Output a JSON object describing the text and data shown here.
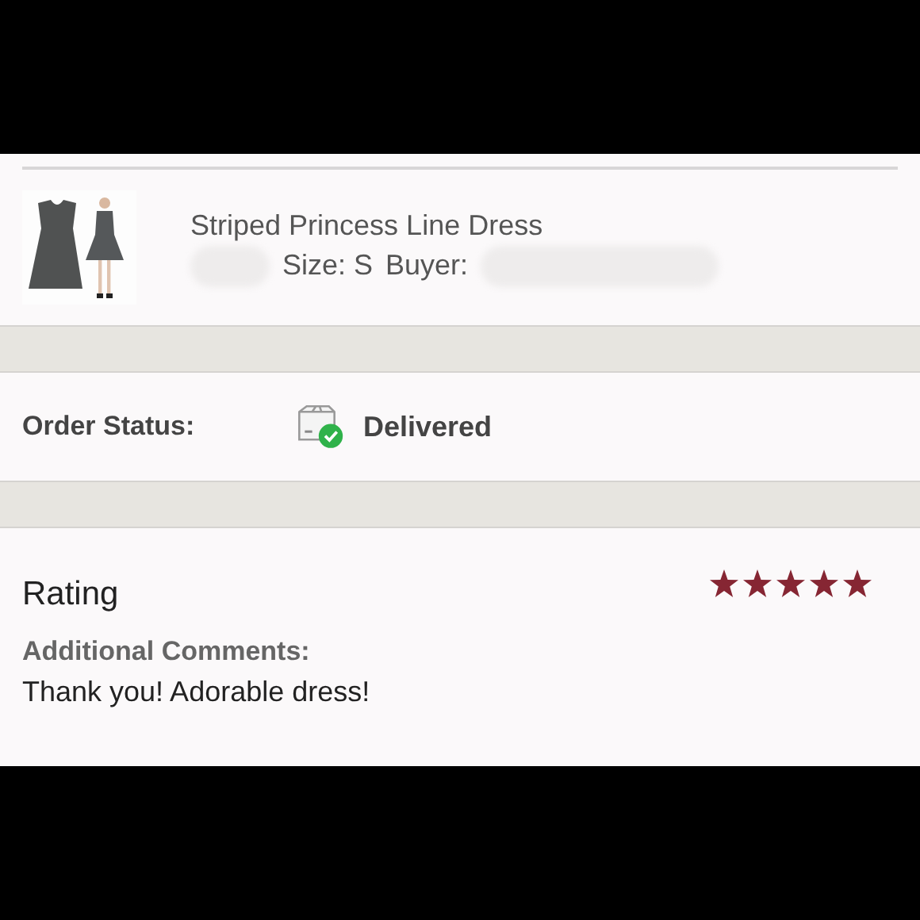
{
  "item": {
    "title": "Striped Princess Line Dress",
    "size": "Size: S",
    "buyer_label": "Buyer:",
    "redacted": true
  },
  "order_status": {
    "label": "Order Status:",
    "status": "Delivered",
    "delivered": true
  },
  "rating": {
    "title": "Rating",
    "stars": 5,
    "comments_label": "Additional Comments:",
    "comments": "Thank you! Adorable dress!"
  }
}
